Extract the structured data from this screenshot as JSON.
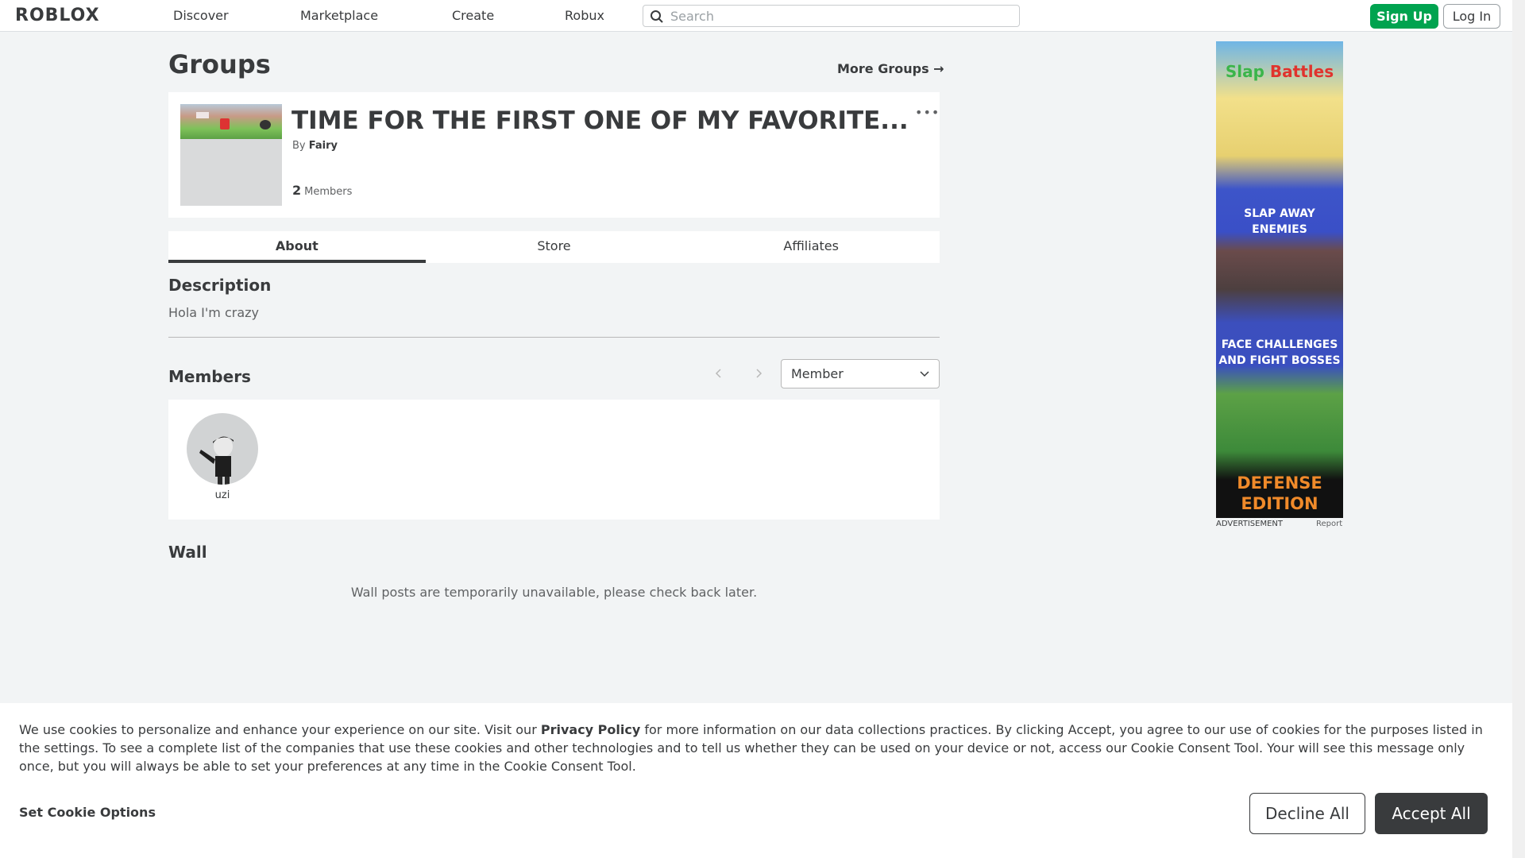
{
  "header": {
    "logo": "ROBLOX",
    "nav": [
      "Discover",
      "Marketplace",
      "Create",
      "Robux"
    ],
    "search_placeholder": "Search",
    "signup_label": "Sign Up",
    "login_label": "Log In"
  },
  "page": {
    "title": "Groups",
    "more_groups": "More Groups →"
  },
  "group": {
    "name": "TIME FOR THE FIRST ONE OF MY FAVORITE...",
    "by_label": "By",
    "owner": "Fairy",
    "member_count": "2",
    "members_label": "Members",
    "more_label": "•••"
  },
  "tabs": [
    "About",
    "Store",
    "Affiliates"
  ],
  "about": {
    "description_title": "Description",
    "description_text": "Hola I'm crazy",
    "members_title": "Members",
    "role_selected": "Member",
    "members": [
      {
        "name": "uzi"
      }
    ],
    "wall_title": "Wall",
    "wall_message": "Wall posts are temporarily unavailable, please check back later."
  },
  "ad": {
    "title_part1": "Slap",
    "title_part2": "Battles",
    "line1": "SLAP AWAY",
    "line2": "ENEMIES",
    "line3": "FACE CHALLENGES",
    "line4": "AND FIGHT BOSSES",
    "line5": "DEFENSE",
    "line6": "EDITION",
    "label": "ADVERTISEMENT",
    "report": "Report"
  },
  "cookie": {
    "text_before": "We use cookies to personalize and enhance your experience on our site. Visit our ",
    "privacy_link": "Privacy Policy",
    "text_after": " for more information on our data collections practices. By clicking Accept, you agree to our use of cookies for the purposes listed in the settings. To see a complete list of the companies that use these cookies and other technologies and to tell us whether they can be used on your device or not, access our Cookie Consent Tool. Your will see this message only once, but you will always be able to set your preferences at any time in the Cookie Consent Tool.",
    "options_label": "Set Cookie Options",
    "decline_label": "Decline All",
    "accept_label": "Accept All"
  }
}
